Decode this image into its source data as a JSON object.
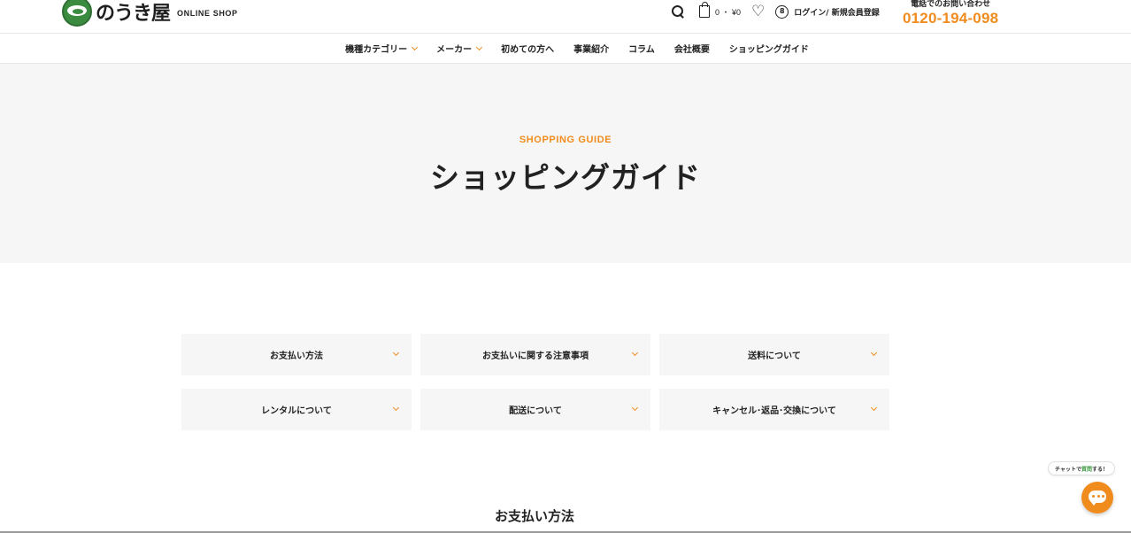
{
  "brand": {
    "logo_text": "のうき屋",
    "shop_label": "ONLINE SHOP",
    "accent_color": "#f08c1e",
    "logo_color": "#3a8a3f"
  },
  "header": {
    "cart_text": "0 ・ ¥0",
    "login_text": "ログイン/ 新規会員登録",
    "tel_label": "電話でのお問い合わせ",
    "tel_number": "0120-194-098",
    "icons": [
      "search-icon",
      "cart-icon",
      "heart-icon",
      "user-icon"
    ]
  },
  "nav": {
    "items": [
      {
        "label": "機種カテゴリー",
        "has_dropdown": true
      },
      {
        "label": "メーカー",
        "has_dropdown": true
      },
      {
        "label": "初めての方へ",
        "has_dropdown": false
      },
      {
        "label": "事業紹介",
        "has_dropdown": false
      },
      {
        "label": "コラム",
        "has_dropdown": false
      },
      {
        "label": "会社概要",
        "has_dropdown": false
      },
      {
        "label": "ショッピングガイド",
        "has_dropdown": false
      }
    ]
  },
  "hero": {
    "kicker": "SHOPPING GUIDE",
    "title": "ショッピングガイド"
  },
  "guide": {
    "items": [
      {
        "label": "お支払い方法"
      },
      {
        "label": "お支払いに関する注意事項"
      },
      {
        "label": "送料について"
      },
      {
        "label": "レンタルについて"
      },
      {
        "label": "配送について"
      },
      {
        "label": "キャンセル･返品･交換について"
      }
    ]
  },
  "section": {
    "title": "お支払い方法"
  },
  "chat": {
    "bubble_prefix": "チャットで",
    "bubble_highlight": "質問",
    "bubble_suffix": "する！"
  }
}
